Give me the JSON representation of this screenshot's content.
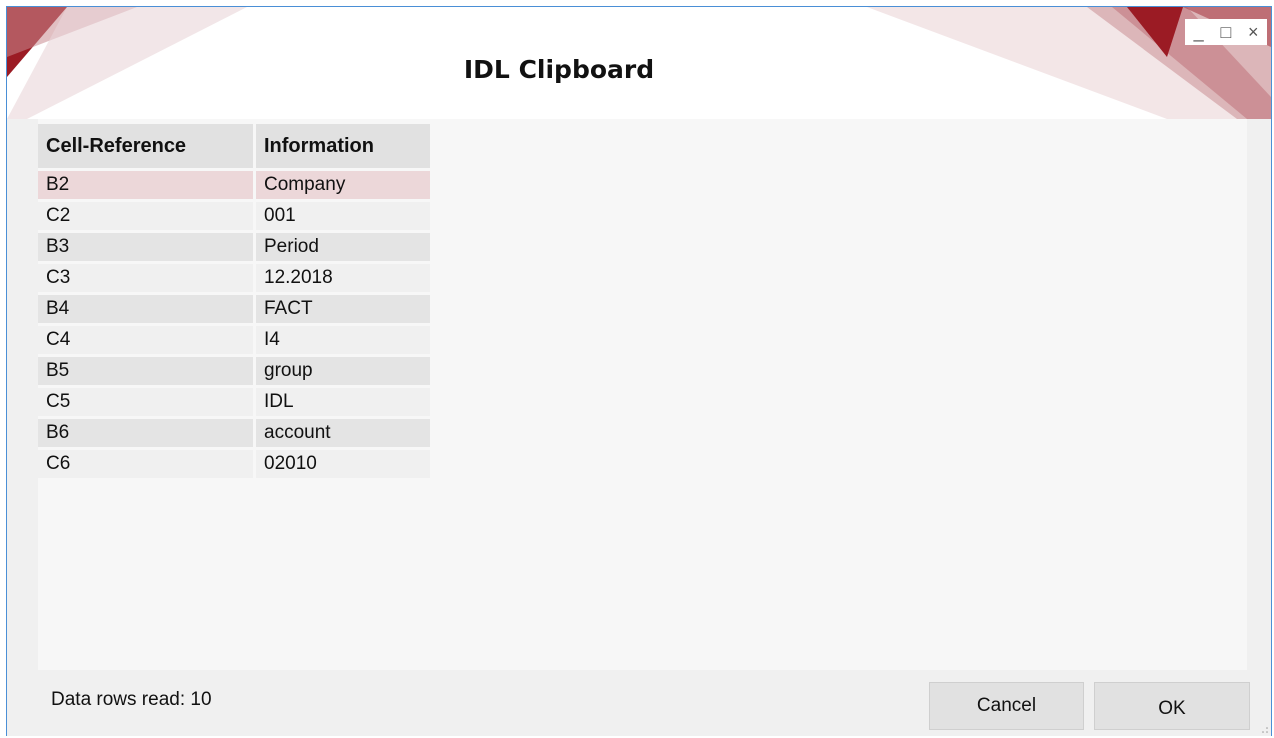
{
  "window": {
    "title": "IDL Clipboard",
    "controls": {
      "minimize": "_",
      "maximize": "□",
      "close": "×"
    }
  },
  "table": {
    "headers": [
      "Cell-Reference",
      "Information"
    ],
    "rows": [
      [
        "B2",
        "Company"
      ],
      [
        "C2",
        "001"
      ],
      [
        "B3",
        "Period"
      ],
      [
        "C3",
        "12.2018"
      ],
      [
        "B4",
        "FACT"
      ],
      [
        "C4",
        "I4"
      ],
      [
        "B5",
        "group"
      ],
      [
        "C5",
        "IDL"
      ],
      [
        "B6",
        "account"
      ],
      [
        "C6",
        "02010"
      ]
    ],
    "selected_row": 0
  },
  "footer": {
    "status": "Data rows read: 10",
    "cancel_label": "Cancel",
    "ok_label": "OK"
  },
  "colors": {
    "accent_dark": "#9b1b24",
    "accent_light": "#d9b3b6",
    "border": "#4a8fd6"
  }
}
